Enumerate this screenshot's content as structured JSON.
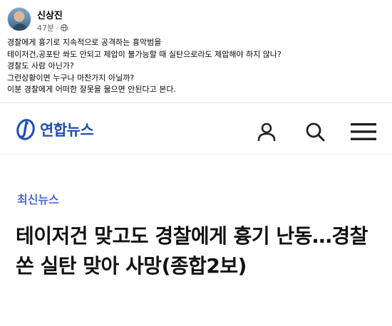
{
  "post": {
    "author": "신상진",
    "time": "47분",
    "separator": "·",
    "lines": [
      "경찰에게 흉기로 지속적으로 공격하는 흉악범을",
      "테이저건,공포탄 쏴도 안되고 제압이 불가능할 때 실탄으로라도 제압해야 하지 않나?",
      "경찰도 사람 아닌가?",
      "그런상황이면 누구나 마찬가지 아닐까?",
      "이분 경찰에게 어떠한 잘못을 물으면 안된다고 본다."
    ]
  },
  "news": {
    "logo_text": "연합뉴스",
    "category": "최신뉴스",
    "headline": "테이저건 맞고도 경찰에게 흉기 난동…경찰 쏜 실탄 맞아 사망(종합2보)",
    "brand_color": "#1e4eb5",
    "category_color": "#4a6bd6",
    "icons": [
      "user-icon",
      "search-icon",
      "menu-icon"
    ]
  }
}
